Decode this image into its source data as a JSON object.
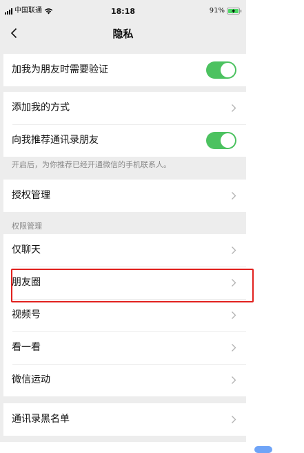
{
  "status_bar": {
    "carrier": "中国联通",
    "time": "18:18",
    "battery": "91%"
  },
  "nav": {
    "title": "隐私",
    "back_icon": "chevron-left-icon"
  },
  "settings": {
    "verify_friend": {
      "label": "加我为朋友时需要验证",
      "toggle_on": true
    },
    "add_method": {
      "label": "添加我的方式"
    },
    "recommend_contacts": {
      "label": "向我推荐通讯录朋友",
      "toggle_on": true
    },
    "recommend_note": "开启后，为你推荐已经开通微信的手机联系人。",
    "authorization": {
      "label": "授权管理"
    },
    "permissions_header": "权限管理",
    "permissions_items": [
      {
        "label": "仅聊天"
      },
      {
        "label": "朋友圈"
      },
      {
        "label": "视频号"
      },
      {
        "label": "看一看"
      },
      {
        "label": "微信运动"
      }
    ],
    "blacklist": {
      "label": "通讯录黑名单"
    }
  },
  "colors": {
    "toggle_on": "#4cc260",
    "highlight_box": "#e1211e",
    "background": "#ededed",
    "note_text": "#888888"
  }
}
